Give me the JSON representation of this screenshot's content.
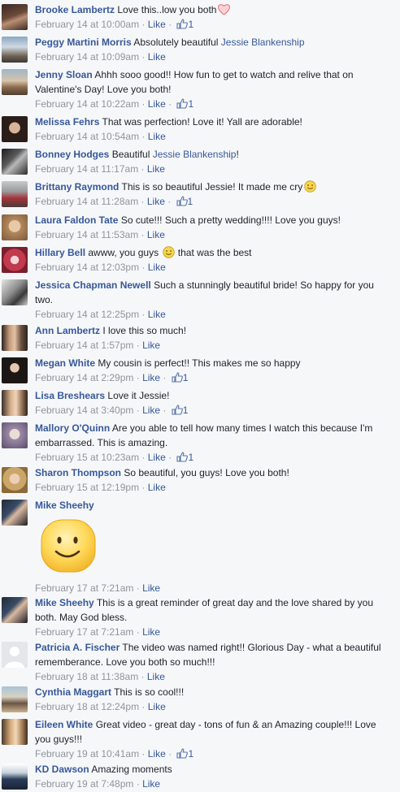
{
  "ui": {
    "like_label": "Like",
    "separator": " · "
  },
  "comments": [
    {
      "author": "Brooke Lambertz",
      "text": "Love this..low you both",
      "time": "February 14 at 10:00am",
      "likes": "1"
    },
    {
      "author": "Peggy Martini Morris",
      "text": "Absolutely beautiful",
      "mention": "Jessie Blankenship",
      "time": "February 14 at 10:09am"
    },
    {
      "author": "Jenny Sloan",
      "text": "Ahhh sooo good!! How fun to get to watch and relive that on Valentine's Day! Love you both!",
      "time": "February 14 at 10:22am",
      "likes": "1"
    },
    {
      "author": "Melissa Fehrs",
      "text": "That was perfection! Love it! Yall are adorable!",
      "time": "February 14 at 10:54am"
    },
    {
      "author": "Bonney Hodges",
      "text": "Beautiful",
      "mention": "Jessie Blankenship",
      "text_after": "!",
      "time": "February 14 at 11:17am"
    },
    {
      "author": "Brittany Raymond",
      "text": "This is so beautiful Jessie! It made me cry",
      "time": "February 14 at 11:28am",
      "likes": "1"
    },
    {
      "author": "Laura Faldon Tate",
      "text": "So cute!!! Such a pretty wedding!!!! Love you guys!",
      "time": "February 14 at 11:53am"
    },
    {
      "author": "Hillary Bell",
      "text": "awww, you guys",
      "text_after": "that was the best",
      "time": "February 14 at 12:03pm"
    },
    {
      "author": "Jessica Chapman Newell",
      "text": "Such a stunningly beautiful bride! So happy for you two.",
      "time": "February 14 at 12:25pm"
    },
    {
      "author": "Ann Lambertz",
      "text": "I love this so much!",
      "time": "February 14 at 1:57pm"
    },
    {
      "author": "Megan White",
      "text": "My cousin is perfect!! This makes me so happy",
      "time": "February 14 at 2:29pm",
      "likes": "1"
    },
    {
      "author": "Lisa Breshears",
      "text": "Love it Jessie!",
      "time": "February 14 at 3:40pm",
      "likes": "1"
    },
    {
      "author": "Mallory O'Quinn",
      "text": "Are you able to tell how many times I watch this because I'm embarrassed. This is amazing.",
      "time": "February 15 at 10:23am",
      "likes": "1"
    },
    {
      "author": "Sharon Thompson",
      "text": "So beautiful, you guys! Love you both!",
      "time": "February 15 at 12:19pm"
    },
    {
      "author": "Mike Sheehy",
      "text": "",
      "time": "February 17 at 7:21am"
    },
    {
      "author": "Mike Sheehy",
      "text": "This is a great reminder of great day and the love shared by you both. May God bless.",
      "time": "February 17 at 7:21am"
    },
    {
      "author": "Patricia A. Fischer",
      "text": "The video was named right!! Glorious Day - what a beautiful rememberance. Love you both so much!!!",
      "time": "February 18 at 11:38am"
    },
    {
      "author": "Cynthia Maggart",
      "text": "This is so cool!!!",
      "time": "February 18 at 12:24pm"
    },
    {
      "author": "Eileen White",
      "text": "Great video - great day - tons of fun & an Amazing couple!!! Love you guys!!!",
      "time": "February 19 at 10:41am",
      "likes": "1"
    },
    {
      "author": "KD Dawson",
      "text": "Amazing moments",
      "time": "February 19 at 7:48pm"
    }
  ]
}
